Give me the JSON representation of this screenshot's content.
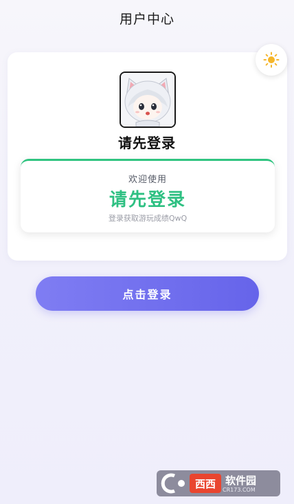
{
  "header": {
    "title": "用户中心"
  },
  "theme_toggle": {
    "icon": "sun-icon"
  },
  "profile": {
    "avatar_icon": "anime-cat-girl-avatar",
    "name": "请先登录"
  },
  "status_card": {
    "welcome": "欢迎使用",
    "title": "请先登录",
    "subtitle": "登录获取游玩成绩QwQ",
    "accent_color": "#2ec082"
  },
  "login_button": {
    "label": "点击登录",
    "color": "#6f6df0"
  },
  "watermark": {
    "brand": "西西",
    "name": "软件园",
    "domain": "CR173.COM"
  }
}
